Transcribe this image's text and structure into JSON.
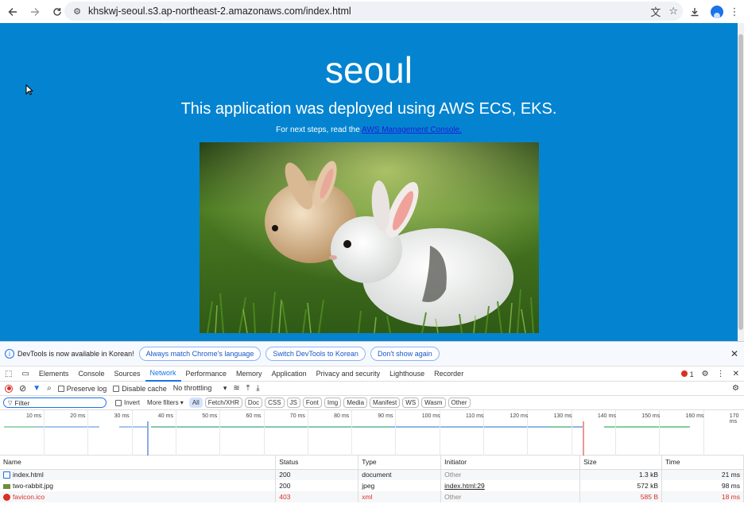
{
  "browser": {
    "url": "khskwj-seoul.s3.ap-northeast-2.amazonaws.com/index.html"
  },
  "page": {
    "title": "seoul",
    "subtitle": "This application was deployed using AWS ECS, EKS.",
    "note_prefix": "For next steps, read the ",
    "note_link": "AWS Management Console."
  },
  "devtools": {
    "info_bar": {
      "message": "DevTools is now available in Korean!",
      "btn_match": "Always match Chrome's language",
      "btn_switch": "Switch DevTools to Korean",
      "btn_dismiss": "Don't show again"
    },
    "tabs": [
      "Elements",
      "Console",
      "Sources",
      "Network",
      "Performance",
      "Memory",
      "Application",
      "Privacy and security",
      "Lighthouse",
      "Recorder"
    ],
    "active_tab": "Network",
    "error_count": "1",
    "net_toolbar": {
      "preserve_log": "Preserve log",
      "disable_cache": "Disable cache",
      "throttling": "No throttling"
    },
    "filter": {
      "placeholder": "Filter",
      "invert": "Invert",
      "more_filters": "More filters",
      "types": [
        "All",
        "Fetch/XHR",
        "Doc",
        "CSS",
        "JS",
        "Font",
        "Img",
        "Media",
        "Manifest",
        "WS",
        "Wasm",
        "Other"
      ],
      "active_type": "All"
    },
    "timeline_ticks": [
      "10 ms",
      "20 ms",
      "30 ms",
      "40 ms",
      "50 ms",
      "60 ms",
      "70 ms",
      "80 ms",
      "90 ms",
      "100 ms",
      "110 ms",
      "120 ms",
      "130 ms",
      "140 ms",
      "150 ms",
      "160 ms",
      "170 ms"
    ],
    "table": {
      "headers": {
        "name": "Name",
        "status": "Status",
        "type": "Type",
        "initiator": "Initiator",
        "size": "Size",
        "time": "Time"
      },
      "rows": [
        {
          "name": "index.html",
          "status": "200",
          "type": "document",
          "initiator": "Other",
          "size": "1.3 kB",
          "time": "21 ms"
        },
        {
          "name": "two-rabbit.jpg",
          "status": "200",
          "type": "jpeg",
          "initiator": "index.html:29",
          "size": "572 kB",
          "time": "98 ms"
        },
        {
          "name": "favicon.ico",
          "status": "403",
          "type": "xml",
          "initiator": "Other",
          "size": "585 B",
          "time": "18 ms"
        }
      ]
    }
  },
  "colors": {
    "page_bg": "#0484d0",
    "accent": "#1a73e8",
    "error": "#d93025"
  }
}
